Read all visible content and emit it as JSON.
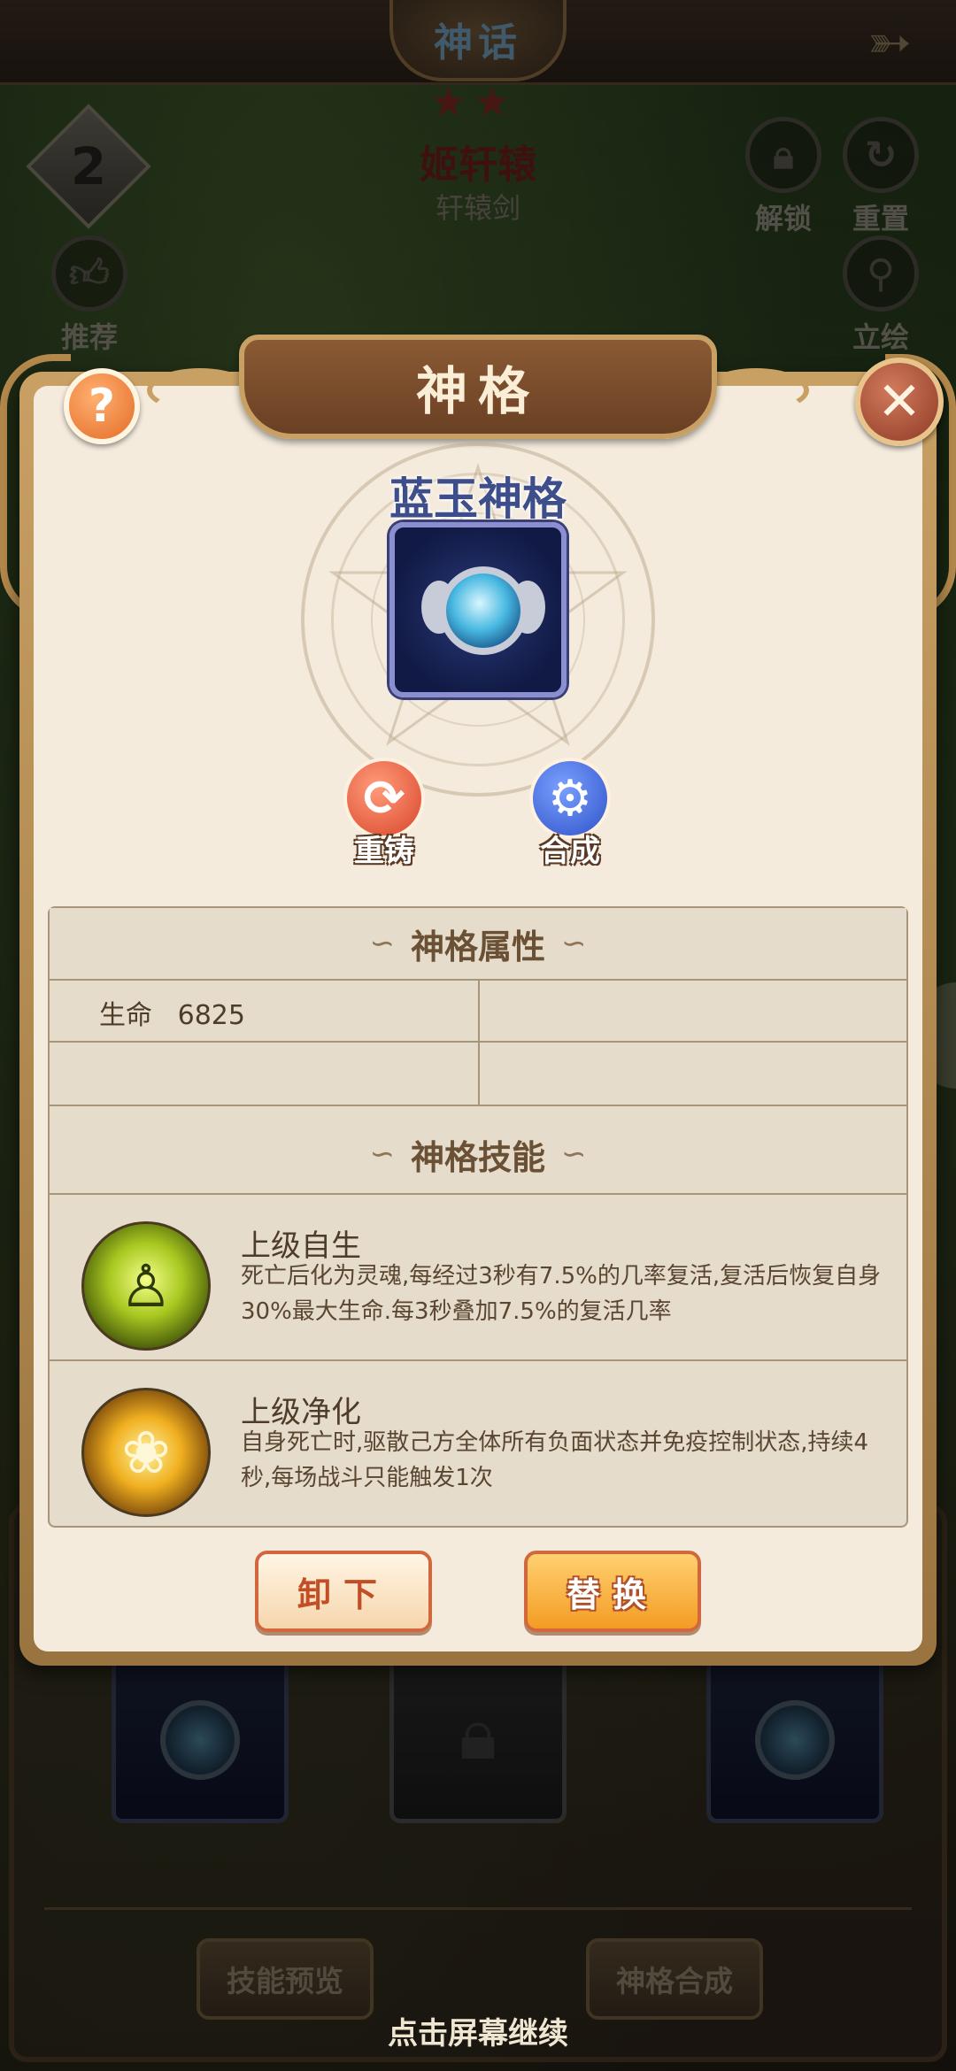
{
  "screen": {
    "title": "神话",
    "stars": 2,
    "hero_name": "姬轩辕",
    "hero_weapon": "轩辕剑",
    "rank": "2",
    "unlock_label": "解锁",
    "reset_label": "重置",
    "recommend_label": "推荐",
    "portrait_label": "立绘",
    "skill_preview_label": "技能预览",
    "synth_label": "神格合成",
    "tap_continue": "点击屏幕继续"
  },
  "dialog": {
    "title": "神格",
    "item_name": "蓝玉神格",
    "reforge_label": "重铸",
    "compose_label": "合成",
    "attributes_header": "神格属性",
    "attributes": [
      {
        "name": "生命",
        "value": "6825"
      }
    ],
    "skills_header": "神格技能",
    "skills": [
      {
        "name": "上级自生",
        "icon": "spirit-icon",
        "desc": "死亡后化为灵魂,每经过3秒有7.5%的几率复活,复活后恢复自身30%最大生命.每3秒叠加7.5%的复活几率"
      },
      {
        "name": "上级净化",
        "icon": "lotus-icon",
        "desc": "自身死亡时,驱散己方全体所有负面状态并免疫控制状态,持续4秒,每场战斗只能触发1次"
      }
    ],
    "unequip_label": "卸下",
    "replace_label": "替换"
  },
  "colors": {
    "item_name": "#3e4e8a",
    "panel_bg": "#f4ebdd",
    "banner": "#7a4c2c",
    "accent_orange": "#f39c24"
  }
}
